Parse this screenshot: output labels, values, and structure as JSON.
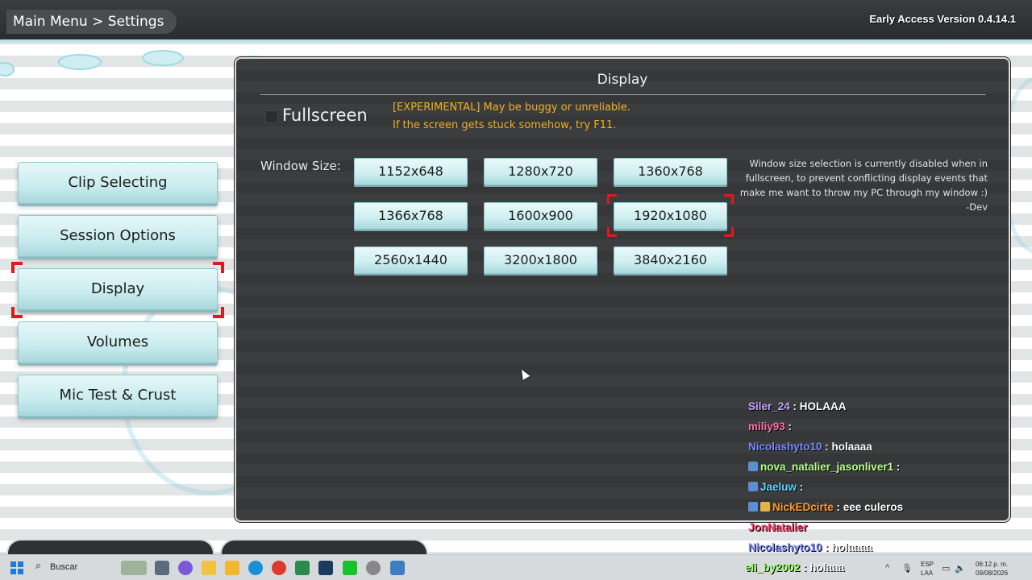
{
  "topbar": {
    "breadcrumb": "Main Menu > Settings",
    "version": "Early Access Version 0.4.14.1"
  },
  "menu": {
    "items": [
      {
        "label": "Clip Selecting"
      },
      {
        "label": "Session Options"
      },
      {
        "label": "Display",
        "selected": true
      },
      {
        "label": "Volumes"
      },
      {
        "label": "Mic Test & Crust"
      }
    ]
  },
  "display": {
    "title": "Display",
    "fullscreen_label": "Fullscreen",
    "fullscreen_checked": false,
    "warning_line1": "[EXPERIMENTAL] May be buggy or unreliable.",
    "warning_line2": "If the screen gets stuck somehow, try F11.",
    "window_size_label": "Window Size:",
    "sizes": [
      "1152x648",
      "1280x720",
      "1360x768",
      "1366x768",
      "1600x900",
      "1920x1080",
      "2560x1440",
      "3200x1800",
      "3840x2160"
    ],
    "selected_size": "1920x1080",
    "note_line1": "Window size selection is currently disabled when in",
    "note_line2": "fullscreen, to prevent conflicting display events that",
    "note_line3": "make me want to throw my PC through my window :)",
    "note_line4": "-Dev"
  },
  "chat": [
    {
      "user": "Siler_24",
      "color": "#c6a6ff",
      "message": " : HOLAAA"
    },
    {
      "user": "miliy93",
      "color": "#ff6fa8",
      "message": " :"
    },
    {
      "user": "Nicolashyto10",
      "color": "#7b8cff",
      "message": " : holaaaa"
    },
    {
      "user": "nova_natalier_jasonliver1",
      "color": "#b9ff8a",
      "message": " :"
    },
    {
      "user": "Jaeluw",
      "color": "#5fd5ff",
      "message": " :"
    },
    {
      "user": "NickEDcirte",
      "color": "#ff9d2e",
      "message": " : eee culeros"
    },
    {
      "user": "JonNatalier",
      "color": "#ff3b6b",
      "message": ""
    },
    {
      "user": "Nicolashyto10",
      "color": "#7b8cff",
      "message": " : holaaaa"
    },
    {
      "user": "eli_by2002",
      "color": "#9cff6e",
      "message": " : holaaa"
    }
  ],
  "taskbar": {
    "search_label": "Buscar",
    "lang_line1": "ESP",
    "lang_line2": "LAA",
    "time": "06:12 p. m.",
    "date": "09/08/2026"
  },
  "colors": {
    "accent": "#c9ecee",
    "selection": "#e0191b",
    "warning": "#f0b020",
    "panel": "#3b3d3e"
  }
}
